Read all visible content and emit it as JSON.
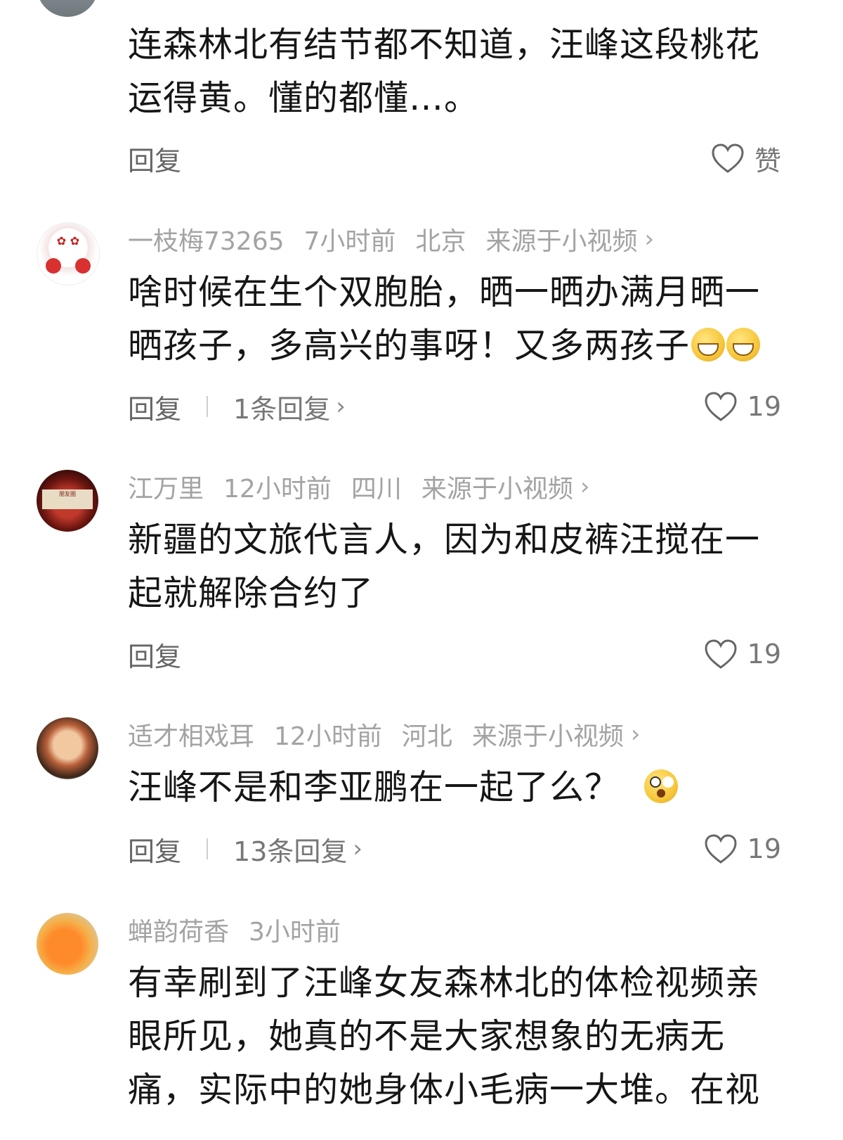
{
  "comments": [
    {
      "username": "",
      "time": "",
      "location": "",
      "source": "",
      "text": "连森林北有结节都不知道，汪峰这段桃花运得黄。懂的都懂…。",
      "emoji": "",
      "reply_label": "回复",
      "thread_label": "",
      "like_label": "赞"
    },
    {
      "username": "一枝梅73265",
      "time": "7小时前",
      "location": "北京",
      "source": "来源于小视频",
      "text": "啥时候在生个双胞胎，晒一晒办满月晒一晒孩子，多高兴的事呀！又多两孩子",
      "emoji": "grin-emoji x2",
      "reply_label": "回复",
      "thread_label": "1条回复",
      "like_label": "19"
    },
    {
      "username": "江万里",
      "time": "12小时前",
      "location": "四川",
      "source": "来源于小视频",
      "text": "新疆的文旅代言人，因为和皮裤汪搅在一起就解除合约了",
      "emoji": "",
      "reply_label": "回复",
      "thread_label": "",
      "like_label": "19"
    },
    {
      "username": "适才相戏耳",
      "time": "12小时前",
      "location": "河北",
      "source": "来源于小视频",
      "text": "汪峰不是和李亚鹏在一起了么？",
      "emoji": "shocked-emoji",
      "reply_label": "回复",
      "thread_label": "13条回复",
      "like_label": "19"
    },
    {
      "username": "蝉韵荷香",
      "time": "3小时前",
      "location": "",
      "source": "",
      "text": "有幸刷到了汪峰女友森林北的体检视频亲眼所见，她真的不是大家想象的无病无痛，实际中的她身体小毛病一大堆。在视",
      "emoji": "",
      "reply_label": "",
      "thread_label": "",
      "like_label": ""
    }
  ],
  "colors": {
    "meta_text": "#a3a3a3",
    "body_text": "#161616",
    "action_text": "#777777"
  }
}
